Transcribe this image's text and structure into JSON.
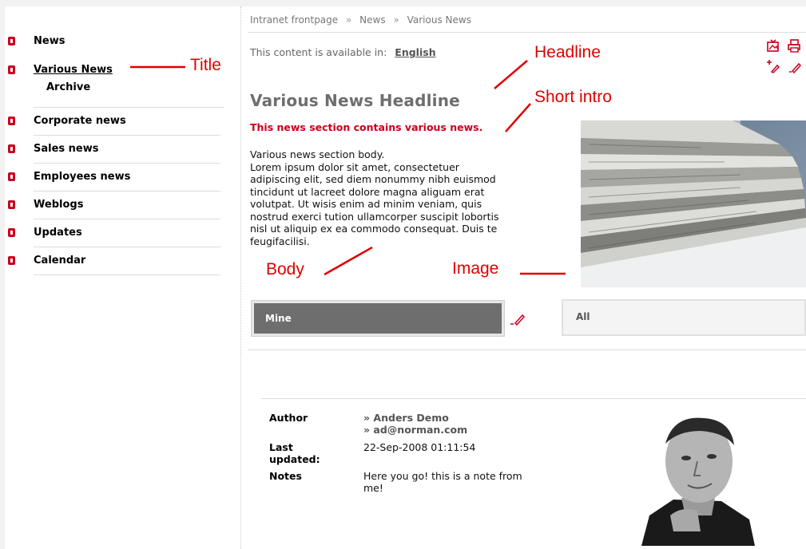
{
  "sidebar": {
    "items": [
      {
        "label": "News"
      },
      {
        "label": "Various News"
      },
      {
        "label": "Corporate news"
      },
      {
        "label": "Sales news"
      },
      {
        "label": "Employees news"
      },
      {
        "label": "Weblogs"
      },
      {
        "label": "Updates"
      },
      {
        "label": "Calendar"
      }
    ],
    "sub_item": "Archive"
  },
  "breadcrumb": [
    "Intranet frontpage",
    "News",
    "Various News"
  ],
  "breadcrumb_sep": "»",
  "language": {
    "text": "This content is available in:",
    "link": "English"
  },
  "article": {
    "headline": "Various News Headline",
    "intro": "This news section contains various news.",
    "body_lines": [
      "Various news section body.",
      "Lorem ipsum dolor sit amet, consectetuer",
      "adipiscing elit, sed diem nonummy nibh euismod",
      "tincidunt ut lacreet dolore magna aliguam erat",
      "volutpat. Ut wisis enim ad minim veniam, quis",
      "nostrud exerci tution ullamcorper suscipit lobortis",
      "nisl ut aliquip ex ea commodo consequat. Duis te",
      "feugifacilisi."
    ]
  },
  "tabs": {
    "mine": "Mine",
    "all": "All"
  },
  "meta": {
    "author_label": "Author",
    "author_name": "» Anders Demo",
    "author_email": "» ad@norman.com",
    "updated_label_1": "Last",
    "updated_label_2": "updated:",
    "updated_value": "22-Sep-2008 01:11:54",
    "notes_label": "Notes",
    "notes_line_1": "Here you go! this is a note from",
    "notes_line_2": "me!"
  },
  "annotations": {
    "title": "Title",
    "headline": "Headline",
    "short_intro": "Short intro",
    "body": "Body",
    "image": "Image"
  },
  "icons": [
    "bullet-icon",
    "image-export-icon",
    "print-icon",
    "add-edit-icon",
    "edit-pencil-icon"
  ],
  "colors": {
    "accent": "#c8001e",
    "annotation": "#e00000",
    "headline": "#6e6e6e",
    "tab_active": "#6e6e6e"
  }
}
